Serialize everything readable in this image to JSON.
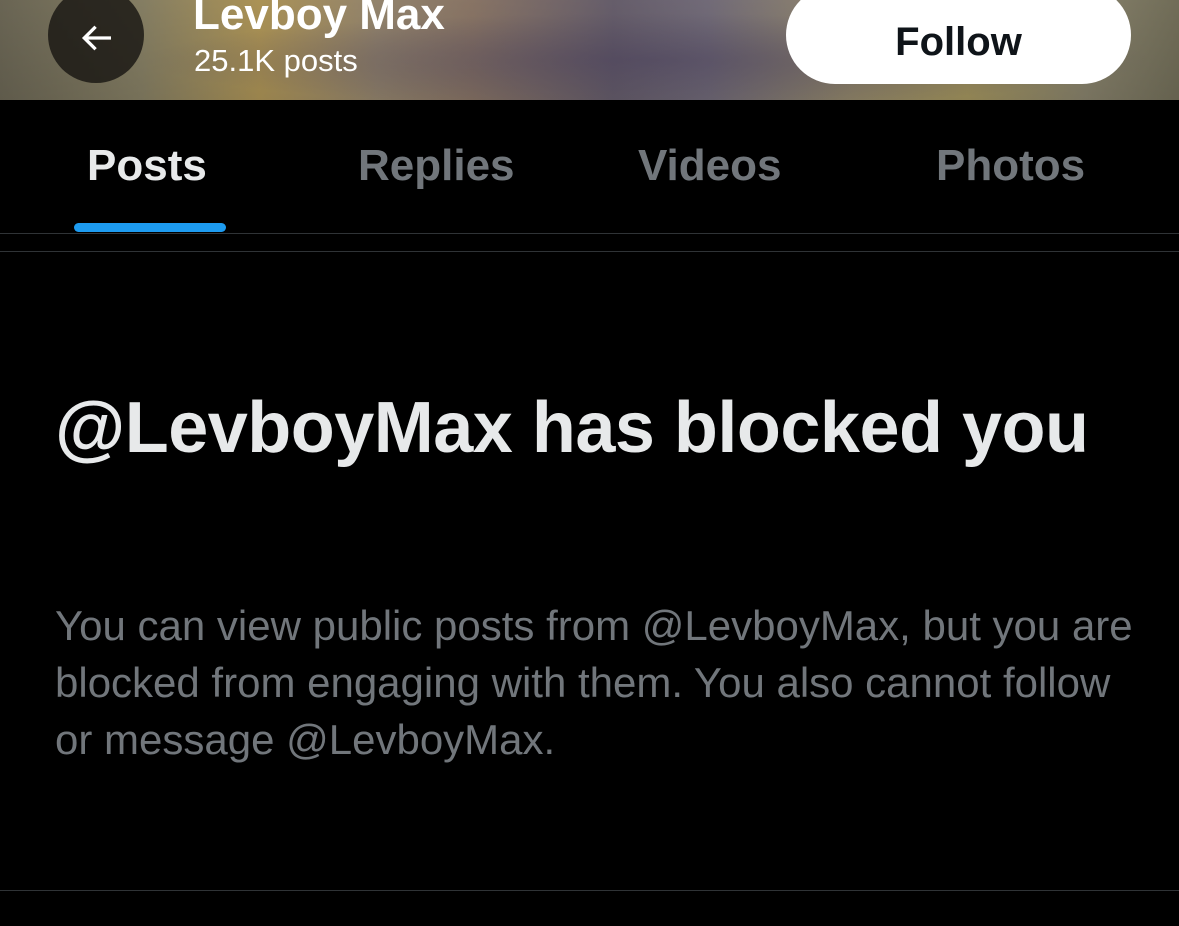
{
  "header": {
    "profile_name": "Levboy Max",
    "post_count": "25.1K posts",
    "follow_label": "Follow",
    "back_icon": "arrow-left-icon"
  },
  "tabs": [
    {
      "label": "Posts",
      "active": true
    },
    {
      "label": "Replies",
      "active": false
    },
    {
      "label": "Videos",
      "active": false
    },
    {
      "label": "Photos",
      "active": false
    }
  ],
  "blocked": {
    "title": "@LevboyMax has blocked you",
    "description": "You can view public posts from @LevboyMax, but you are blocked from engaging with them. You also cannot follow or message @LevboyMax."
  },
  "colors": {
    "background": "#000000",
    "accent": "#1d9bf0",
    "primary_text": "#e7e9ea",
    "secondary_text": "#71767b"
  }
}
